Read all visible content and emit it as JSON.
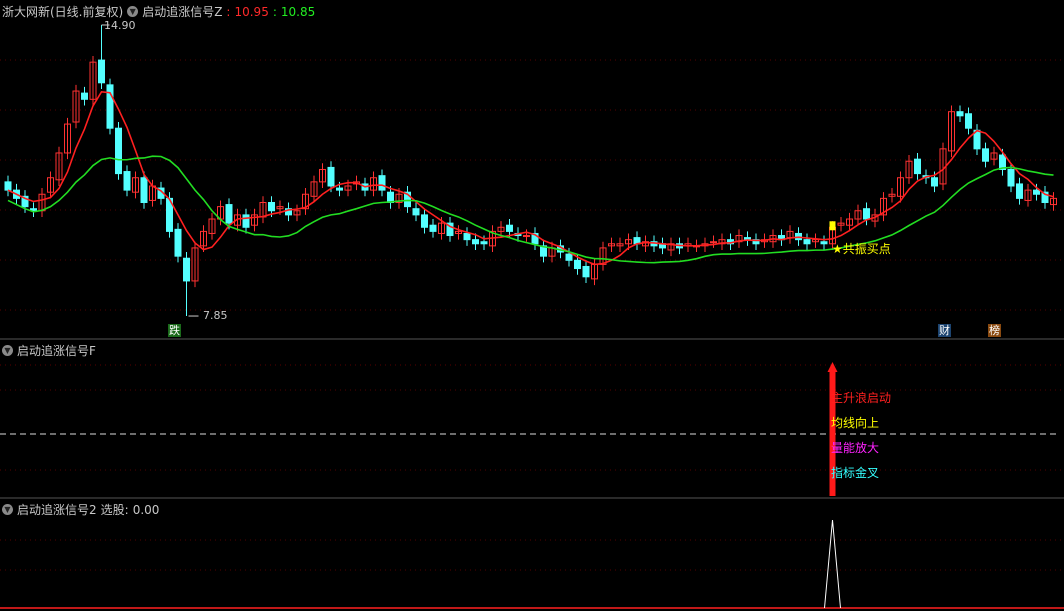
{
  "main_panel": {
    "title": "浙大网新(日线.前复权)",
    "indicator_name": "启动追涨信号Z",
    "value_red": "10.95",
    "value_green": "10.85",
    "high_label": "14.90",
    "low_label": "7.85",
    "buy_signal_label": "★共振买点",
    "tags": [
      "跌",
      "财",
      "榜"
    ]
  },
  "panel2": {
    "title": "启动追涨信号F",
    "signals": [
      "主升浪启动",
      "均线向上",
      "量能放大",
      "指标金叉"
    ]
  },
  "panel3": {
    "title": "启动追涨信号2",
    "value_label": "选股:",
    "value": "0.00"
  },
  "colors": {
    "up": "#ff3232",
    "down": "#54ffff",
    "ma_short": "#ff2020",
    "ma_long": "#22dd22",
    "signal": "#ffff00"
  },
  "chart_data": {
    "type": "candlestick",
    "price_high": 14.9,
    "price_low": 7.85,
    "closes": [
      10.9,
      10.7,
      10.5,
      10.4,
      10.8,
      11.2,
      11.8,
      12.5,
      13.3,
      13.1,
      14.0,
      13.5,
      12.4,
      11.3,
      10.9,
      11.2,
      10.6,
      11.0,
      10.7,
      9.9,
      9.3,
      8.7,
      9.5,
      9.9,
      10.2,
      10.5,
      10.1,
      10.3,
      10.0,
      10.3,
      10.6,
      10.4,
      10.5,
      10.3,
      10.4,
      10.8,
      11.1,
      11.4,
      11.0,
      10.9,
      11.0,
      11.1,
      10.9,
      11.2,
      10.9,
      10.6,
      10.8,
      10.5,
      10.3,
      10.0,
      9.9,
      10.1,
      9.8,
      9.9,
      9.7,
      9.6,
      9.6,
      9.9,
      10.0,
      9.9,
      9.8,
      9.8,
      9.6,
      9.3,
      9.5,
      9.4,
      9.2,
      9.0,
      8.8,
      9.1,
      9.5,
      9.6,
      9.6,
      9.7,
      9.6,
      9.65,
      9.55,
      9.5,
      9.6,
      9.5,
      9.6,
      9.55,
      9.6,
      9.65,
      9.7,
      9.6,
      9.8,
      9.7,
      9.6,
      9.7,
      9.8,
      9.7,
      9.9,
      9.7,
      9.6,
      9.7,
      9.6,
      10.0,
      10.1,
      10.2,
      10.4,
      10.2,
      10.3,
      10.7,
      10.8,
      11.2,
      11.6,
      11.3,
      11.2,
      11.0,
      11.9,
      12.8,
      12.7,
      12.4,
      11.9,
      11.6,
      11.8,
      11.4,
      11.0,
      10.7,
      10.9,
      10.8,
      10.6,
      10.7
    ],
    "signal_index": 97
  }
}
